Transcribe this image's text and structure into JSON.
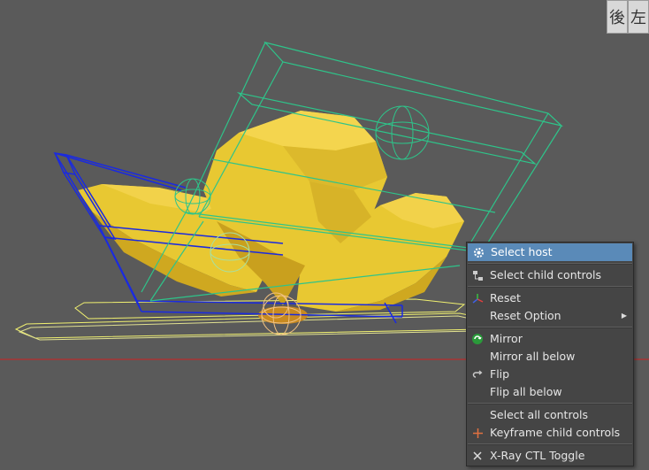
{
  "view_buttons": {
    "back": "後",
    "left": "左"
  },
  "colors": {
    "background": "#5a5a5a",
    "mesh_fill": "#e8c832",
    "controller_blue": "#1a2ae0",
    "controller_green": "#2ec48a",
    "controller_yellow": "#f0f070",
    "ground_line": "#d02020",
    "menu_bg": "#454545",
    "menu_highlight": "#5a8ab8"
  },
  "context_menu": {
    "items": [
      {
        "label": "Select host",
        "icon": "gear-icon",
        "highlighted": true
      },
      {
        "label": "Select child controls",
        "icon": "hierarchy-icon"
      },
      {
        "label": "Reset",
        "icon": "axis-icon"
      },
      {
        "label": "Reset Option",
        "icon": "",
        "submenu": true
      },
      {
        "label": "Mirror",
        "icon": "mirror-icon"
      },
      {
        "label": "Mirror all below",
        "icon": ""
      },
      {
        "label": "Flip",
        "icon": "flip-arrow-icon"
      },
      {
        "label": "Flip all below",
        "icon": ""
      },
      {
        "label": "Select all controls",
        "icon": ""
      },
      {
        "label": "Keyframe child controls",
        "icon": "keyframe-plus-icon"
      },
      {
        "label": "X-Ray CTL Toggle",
        "icon": "close-x-icon"
      }
    ]
  }
}
